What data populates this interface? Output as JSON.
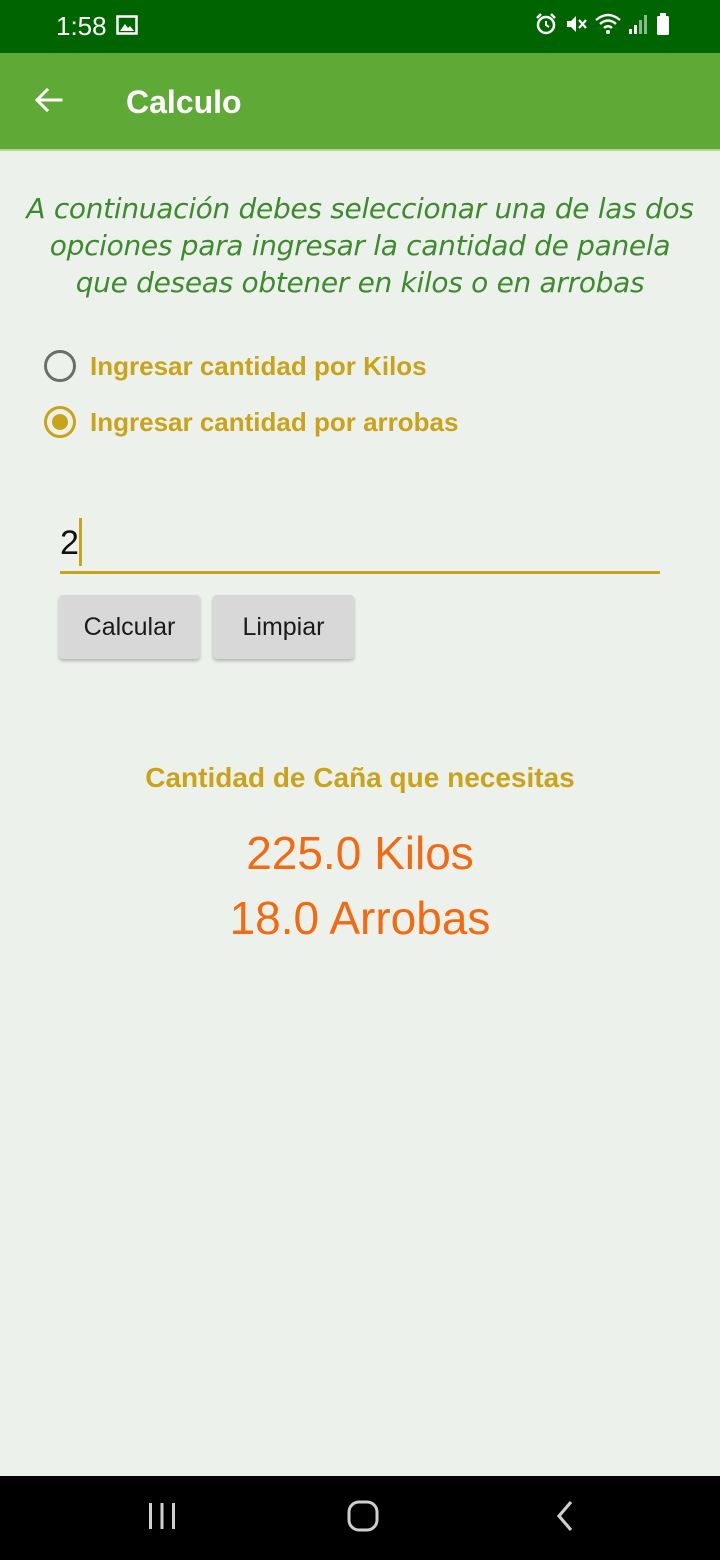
{
  "status_bar": {
    "time": "1:58",
    "icons": [
      "gallery-icon",
      "alarm-icon",
      "mute-icon",
      "wifi-icon",
      "signal-icon",
      "battery-icon"
    ]
  },
  "app_bar": {
    "title": "Calculo",
    "back_icon": "arrow-left-icon"
  },
  "main": {
    "instructions": "A continuación debes seleccionar una de las dos opciones para ingresar la cantidad de panela que deseas obtener en kilos o en arrobas",
    "options": [
      {
        "label": "Ingresar cantidad por Kilos",
        "checked": false
      },
      {
        "label": "Ingresar cantidad por arrobas",
        "checked": true
      }
    ],
    "quantity_value": "2",
    "buttons": {
      "calculate_label": "Calcular",
      "clear_label": "Limpiar"
    },
    "result": {
      "heading": "Cantidad de Caña que necesitas",
      "kilos": "225.0 Kilos",
      "arrobas": "18.0 Arrobas"
    }
  },
  "nav_bar": {
    "icons": [
      "recent-apps-icon",
      "home-icon",
      "back-icon"
    ]
  },
  "colors": {
    "status_bar": "#006400",
    "app_bar": "#5FAA36",
    "accent": "#C9A31A",
    "instructions_text": "#3E8A2E",
    "result_text": "#F26A12",
    "background": "#EDF1EC"
  }
}
